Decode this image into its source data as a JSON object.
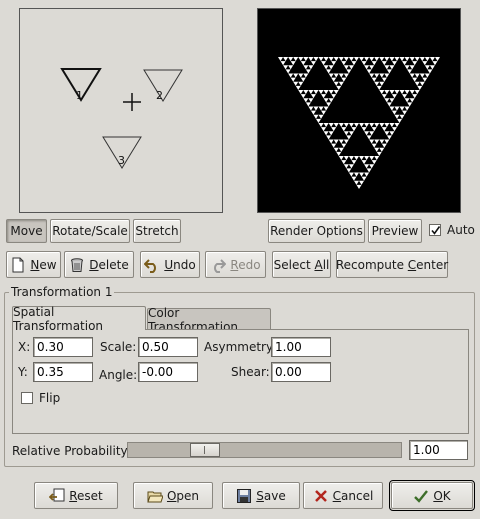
{
  "preview": {
    "handles": [
      "1",
      "2",
      "3"
    ]
  },
  "mode": {
    "move": "Move",
    "rotate_scale": "Rotate/Scale",
    "stretch": "Stretch",
    "render_options": "Render Options",
    "preview": "Preview",
    "auto_label": "Auto",
    "auto_checked": true
  },
  "toolbar": {
    "new_u": "N",
    "new_rest": "ew",
    "delete_u": "D",
    "delete_rest": "elete",
    "undo_u": "U",
    "undo_rest": "ndo",
    "redo_u": "R",
    "redo_rest": "edo",
    "select_all_pre": "Select ",
    "select_all_u": "A",
    "select_all_rest": "ll",
    "recompute_pre": "Recompute ",
    "recompute_u": "C",
    "recompute_rest": "enter"
  },
  "transformation": {
    "frame_title": "Transformation 1",
    "tabs": [
      "Spatial Transformation",
      "Color Transformation"
    ],
    "x_label": "X:",
    "x_value": "0.30",
    "y_label": "Y:",
    "y_value": "0.35",
    "scale_label": "Scale:",
    "scale_value": "0.50",
    "angle_label": "Angle:",
    "angle_value": "-0.00",
    "asymmetry_label": "Asymmetry:",
    "asymmetry_value": "1.00",
    "shear_label": "Shear:",
    "shear_value": "0.00",
    "flip_label": "Flip"
  },
  "probability": {
    "label": "Relative Probability:",
    "value": "1.00",
    "level": 0.18
  },
  "actions": {
    "reset_u": "R",
    "reset_rest": "eset",
    "open_u": "O",
    "open_rest": "pen",
    "save_u": "S",
    "save_rest": "ave",
    "cancel_u": "C",
    "cancel_rest": "ancel",
    "ok_u": "O",
    "ok_rest": "K"
  }
}
